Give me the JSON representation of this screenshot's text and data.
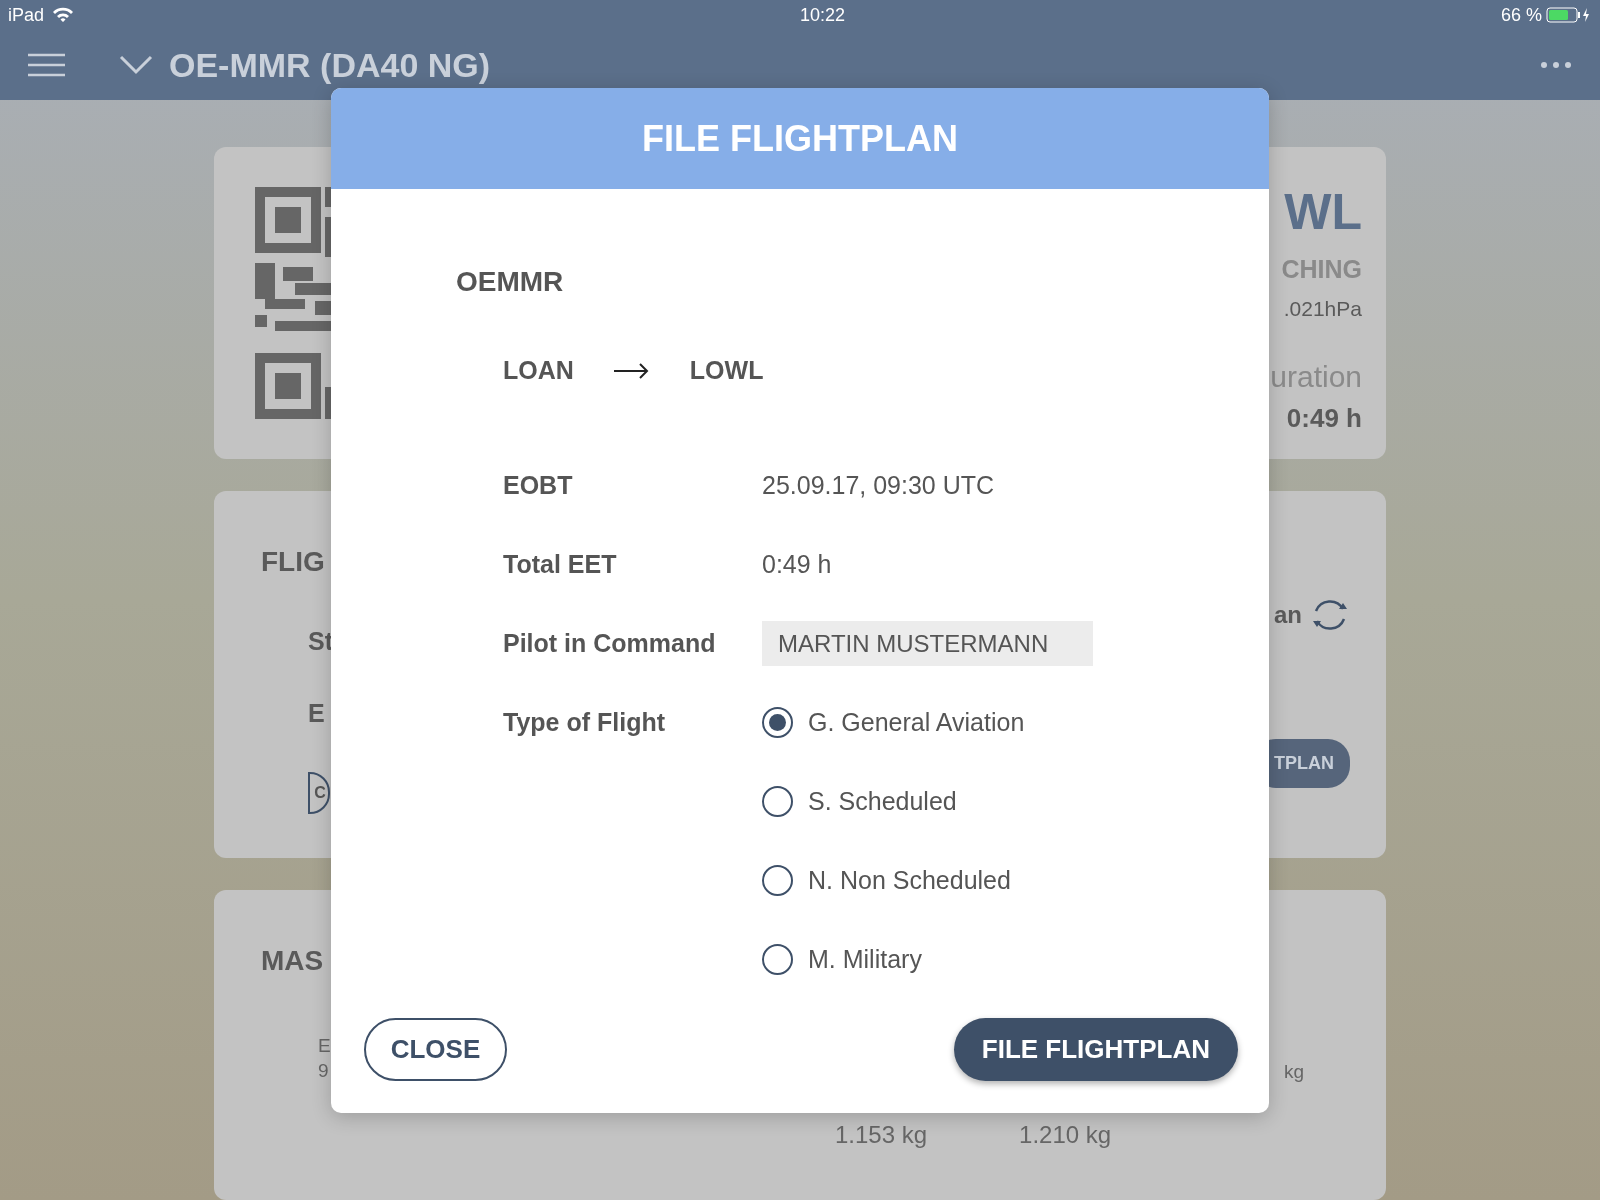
{
  "status_bar": {
    "device": "iPad",
    "time": "10:22",
    "battery": "66 %"
  },
  "nav_bar": {
    "title": "OE-MMR (DA40 NG)"
  },
  "background": {
    "route_card": {
      "destination": "WL",
      "destination_name": "CHING",
      "pressure": ".021hPa",
      "duration_label": "uration",
      "duration": "0:49 h"
    },
    "flight_card": {
      "title": "FLIG",
      "rows": [
        "St",
        "E"
      ],
      "status": "an",
      "left_button": "C",
      "right_button": "TPLAN"
    },
    "mass_card": {
      "title": "MAS",
      "cell_lines": [
        "E",
        "9"
      ],
      "unit": "kg",
      "values": [
        "1.153 kg",
        "1.210 kg"
      ]
    }
  },
  "dialog": {
    "title": "FILE FLIGHTPLAN",
    "callsign": "OEMMR",
    "route": {
      "from": "LOAN",
      "to": "LOWL"
    },
    "fields": [
      {
        "label": "EOBT",
        "value": "25.09.17, 09:30 UTC",
        "kind": "text"
      },
      {
        "label": "Total EET",
        "value": "0:49 h",
        "kind": "text"
      },
      {
        "label": "Pilot in Command",
        "value": "MARTIN MUSTERMANN",
        "kind": "input"
      }
    ],
    "type_of_flight": {
      "label": "Type of Flight",
      "options": [
        {
          "label": "G. General Aviation",
          "selected": true
        },
        {
          "label": "S. Scheduled",
          "selected": false
        },
        {
          "label": "N. Non Scheduled",
          "selected": false
        },
        {
          "label": "M. Military",
          "selected": false
        }
      ]
    },
    "buttons": {
      "close": "CLOSE",
      "submit": "FILE FLIGHTPLAN"
    }
  }
}
